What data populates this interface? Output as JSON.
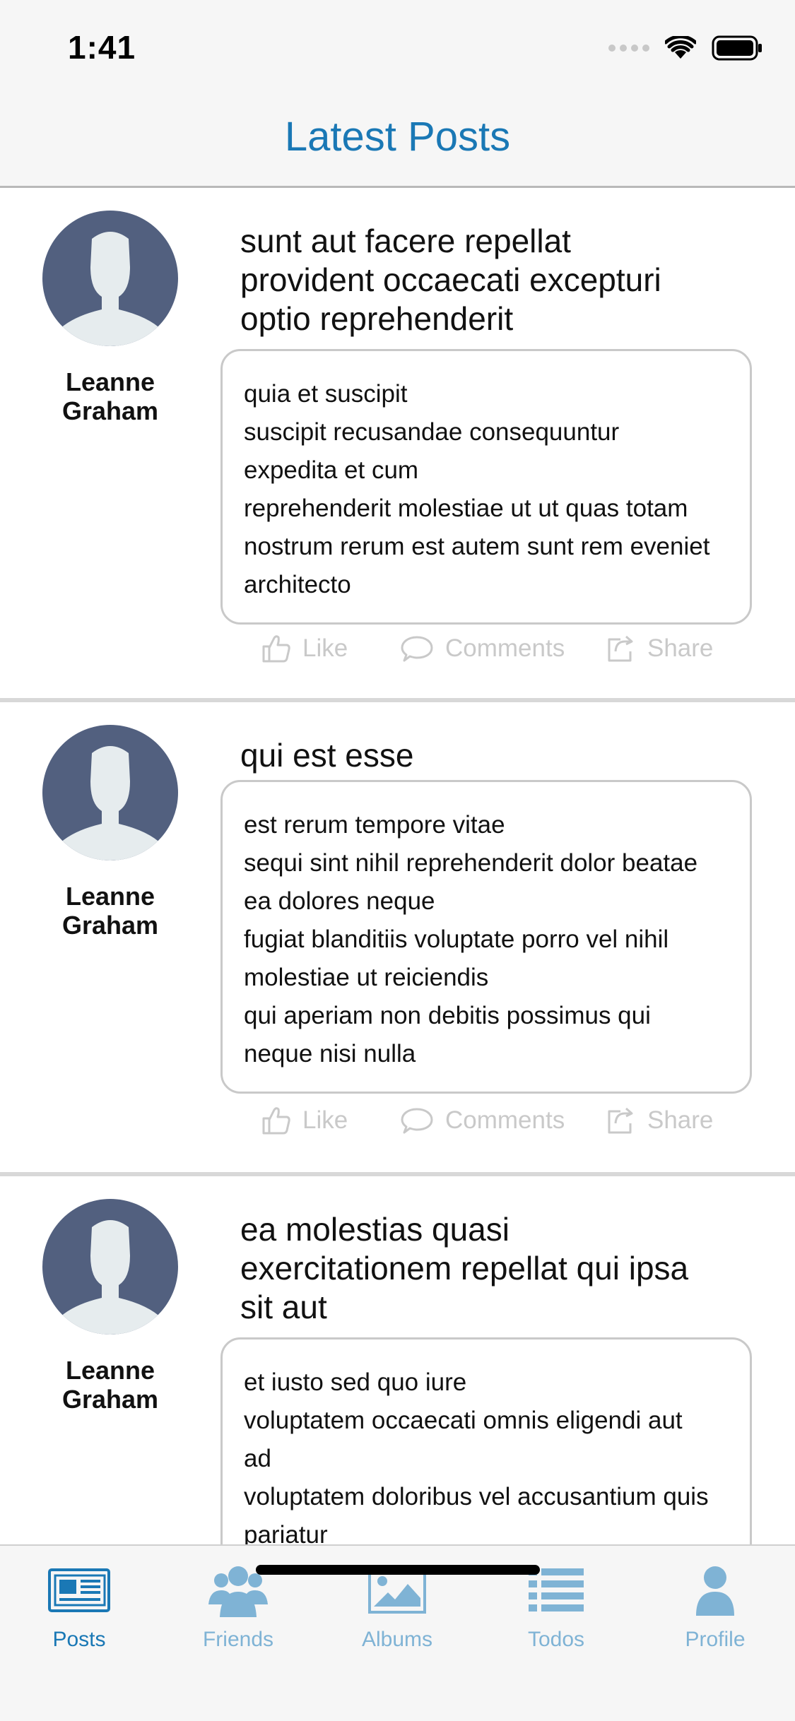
{
  "status_bar": {
    "time": "1:41",
    "icons": [
      "cellular-signal-icon",
      "wifi-icon",
      "battery-icon"
    ]
  },
  "header": {
    "title": "Latest Posts"
  },
  "posts": [
    {
      "author_first": "Leanne",
      "author_last": "Graham",
      "title_lines": [
        "sunt aut facere repellat",
        "provident occaecati excepturi",
        "optio reprehenderit"
      ],
      "body_lines": [
        "quia et suscipit",
        "suscipit recusandae consequuntur",
        "expedita et cum",
        "reprehenderit molestiae ut ut quas totam",
        "nostrum rerum est autem sunt rem eveniet",
        "architecto"
      ]
    },
    {
      "author_first": "Leanne",
      "author_last": "Graham",
      "title_lines": [
        "qui est esse"
      ],
      "body_lines": [
        "est rerum tempore vitae",
        "sequi sint nihil reprehenderit dolor beatae",
        "ea dolores neque",
        "fugiat blanditiis voluptate porro vel nihil",
        "molestiae ut reiciendis",
        "qui aperiam non debitis possimus qui",
        "neque nisi nulla"
      ]
    },
    {
      "author_first": "Leanne",
      "author_last": "Graham",
      "title_lines": [
        "ea molestias quasi",
        "exercitationem repellat qui ipsa",
        "sit aut"
      ],
      "body_lines": [
        "et iusto sed quo iure",
        "voluptatem occaecati omnis eligendi aut",
        "ad",
        "voluptatem doloribus vel accusantium quis",
        "pariatur"
      ]
    }
  ],
  "actions": {
    "like": "Like",
    "comments": "Comments",
    "share": "Share"
  },
  "tabs": [
    {
      "label": "Posts",
      "icon": "newspaper-icon",
      "active": true
    },
    {
      "label": "Friends",
      "icon": "friends-icon",
      "active": false
    },
    {
      "label": "Albums",
      "icon": "image-icon",
      "active": false
    },
    {
      "label": "Todos",
      "icon": "list-icon",
      "active": false
    },
    {
      "label": "Profile",
      "icon": "profile-icon",
      "active": false
    }
  ],
  "colors": {
    "accent": "#1a78b5",
    "tab_inactive": "#7fb3d5",
    "avatar_bg": "#52607f",
    "avatar_silhouette": "#e6ecee",
    "action_gray": "#c9c9c9"
  }
}
